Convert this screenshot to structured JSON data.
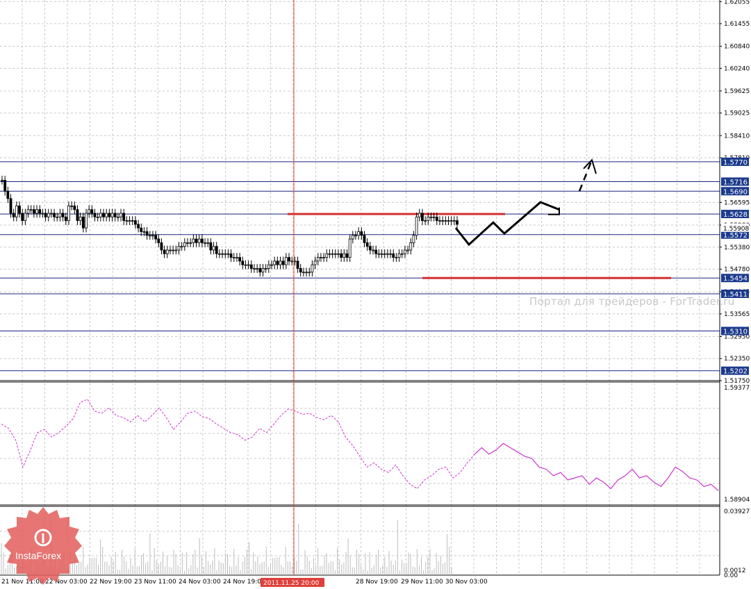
{
  "chart_data": [
    {
      "type": "candlestick",
      "panel": "main",
      "symbol_note": "",
      "y_ticks": [
        "1.62055",
        "1.61455",
        "1.60840",
        "1.60240",
        "1.59625",
        "1.59025",
        "1.58410",
        "1.57810",
        "1.56595",
        "1.55980",
        "1.55380",
        "1.54780",
        "1.54165",
        "1.53565",
        "1.52950",
        "1.52350",
        "1.51750"
      ],
      "ylim": [
        1.5175,
        1.6206
      ],
      "levels": [
        {
          "label": "1.5770",
          "value": 1.577,
          "color": "#1a237e"
        },
        {
          "label": "1.5716",
          "value": 1.5716,
          "color": "#1a237e"
        },
        {
          "label": "1.5690",
          "value": 1.569,
          "color": "#1a237e"
        },
        {
          "label": "1.5628",
          "value": 1.5628,
          "color": "#1a237e"
        },
        {
          "label": "1.5572",
          "value": 1.5572,
          "color": "#1a237e"
        },
        {
          "label": "1.5454",
          "value": 1.5454,
          "color": "#1a237e"
        },
        {
          "label": "1.5411",
          "value": 1.5411,
          "color": "#1a237e"
        },
        {
          "label": "1.5310",
          "value": 1.531,
          "color": "#1a237e"
        },
        {
          "label": "1.5202",
          "value": 1.5202,
          "color": "#1a237e"
        }
      ],
      "current_price": {
        "label": "1.55908",
        "value": 1.55908
      },
      "resistance_line": {
        "value": 1.5628,
        "color": "#d32f2f"
      },
      "support_line": {
        "value": 1.5454,
        "color": "#d32f2f"
      },
      "close_series": [
        1.572,
        1.569,
        1.567,
        1.563,
        1.562,
        1.565,
        1.563,
        1.561,
        1.563,
        1.564,
        1.564,
        1.563,
        1.564,
        1.563,
        1.563,
        1.562,
        1.563,
        1.563,
        1.562,
        1.562,
        1.563,
        1.562,
        1.561,
        1.565,
        1.565,
        1.564,
        1.561,
        1.562,
        1.559,
        1.563,
        1.564,
        1.563,
        1.562,
        1.562,
        1.563,
        1.562,
        1.563,
        1.562,
        1.563,
        1.562,
        1.562,
        1.563,
        1.561,
        1.561,
        1.561,
        1.561,
        1.56,
        1.559,
        1.558,
        1.558,
        1.557,
        1.557,
        1.557,
        1.556,
        1.555,
        1.553,
        1.552,
        1.553,
        1.553,
        1.553,
        1.553,
        1.554,
        1.554,
        1.555,
        1.555,
        1.555,
        1.556,
        1.555,
        1.556,
        1.555,
        1.555,
        1.555,
        1.553,
        1.554,
        1.552,
        1.552,
        1.552,
        1.552,
        1.552,
        1.551,
        1.551,
        1.551,
        1.55,
        1.549,
        1.549,
        1.549,
        1.548,
        1.548,
        1.548,
        1.547,
        1.548,
        1.548,
        1.549,
        1.549,
        1.55,
        1.549,
        1.55,
        1.549,
        1.551,
        1.55,
        1.55,
        1.55,
        1.548,
        1.547,
        1.547,
        1.547,
        1.547,
        1.549,
        1.55,
        1.551,
        1.551,
        1.551,
        1.552,
        1.552,
        1.552,
        1.552,
        1.552,
        1.551,
        1.552,
        1.551,
        1.556,
        1.557,
        1.557,
        1.558,
        1.557,
        1.555,
        1.554,
        1.553,
        1.553,
        1.552,
        1.552,
        1.552,
        1.552,
        1.552,
        1.552,
        1.551,
        1.551,
        1.552,
        1.552,
        1.553,
        1.553,
        1.555,
        1.557,
        1.562,
        1.563,
        1.561,
        1.561,
        1.562,
        1.562,
        1.562,
        1.561,
        1.561,
        1.561,
        1.561,
        1.561,
        1.561,
        1.561,
        1.56
      ],
      "forecast_path": [
        [
          1.559,
          0
        ],
        [
          1.5545,
          1
        ],
        [
          1.5605,
          2
        ],
        [
          1.5575,
          3
        ],
        [
          1.566,
          4
        ],
        [
          1.564,
          5
        ]
      ],
      "forecast_dashed": [
        [
          1.569,
          0
        ],
        [
          1.5775,
          1
        ]
      ],
      "x_ticks": [
        "21 Nov 11:00",
        "22 Nov 03:00",
        "22 Nov 19:00",
        "23 Nov 11:00",
        "24 Nov 03:00",
        "24 Nov 19:00",
        "2011.11.25 20:00",
        "28 Nov 19:00",
        "29 Nov 11:00",
        "30 Nov 03:00"
      ],
      "crosshair_time": "2011.11.25 20:00"
    },
    {
      "type": "line",
      "panel": "indicator_1",
      "y_ticks": [
        "1.59377",
        "1.58904"
      ],
      "ylim": [
        1.58904,
        1.59377
      ],
      "series": [
        {
          "values": [
            0.7,
            0.66,
            0.55,
            0.3,
            0.45,
            0.62,
            0.65,
            0.58,
            0.62,
            0.68,
            0.75,
            0.9,
            0.93,
            0.82,
            0.8,
            0.85,
            0.78,
            0.76,
            0.72,
            0.78,
            0.72,
            0.78,
            0.85,
            0.76,
            0.65,
            0.72,
            0.8,
            0.82,
            0.77,
            0.75,
            0.7,
            0.66,
            0.62,
            0.6,
            0.55,
            0.58,
            0.66,
            0.62,
            0.7,
            0.78,
            0.84,
            0.82,
            0.79,
            0.8,
            0.76,
            0.74,
            0.78,
            0.72,
            0.58,
            0.5,
            0.4,
            0.3,
            0.34,
            0.28,
            0.25,
            0.32,
            0.22,
            0.14,
            0.1,
            0.18,
            0.22,
            0.28,
            0.3,
            0.2,
            0.25,
            0.34,
            0.42,
            0.48,
            0.42,
            0.46,
            0.52,
            0.48,
            0.44,
            0.4,
            0.38,
            0.3,
            0.28,
            0.22,
            0.25,
            0.18,
            0.2,
            0.22,
            0.14,
            0.2,
            0.16,
            0.1,
            0.18,
            0.22,
            0.28,
            0.2,
            0.22,
            0.16,
            0.12,
            0.2,
            0.3,
            0.26,
            0.2,
            0.18,
            0.12,
            0.14,
            0.08
          ]
        }
      ]
    },
    {
      "type": "bar",
      "panel": "indicator_2",
      "y_ticks": [
        "0.03927",
        "0.0012",
        "0.00"
      ],
      "ylim": [
        0,
        0.03927
      ]
    }
  ],
  "watermark": "Портал для трейдеров - ForTrader.ru",
  "logo_text": "InstaForex"
}
